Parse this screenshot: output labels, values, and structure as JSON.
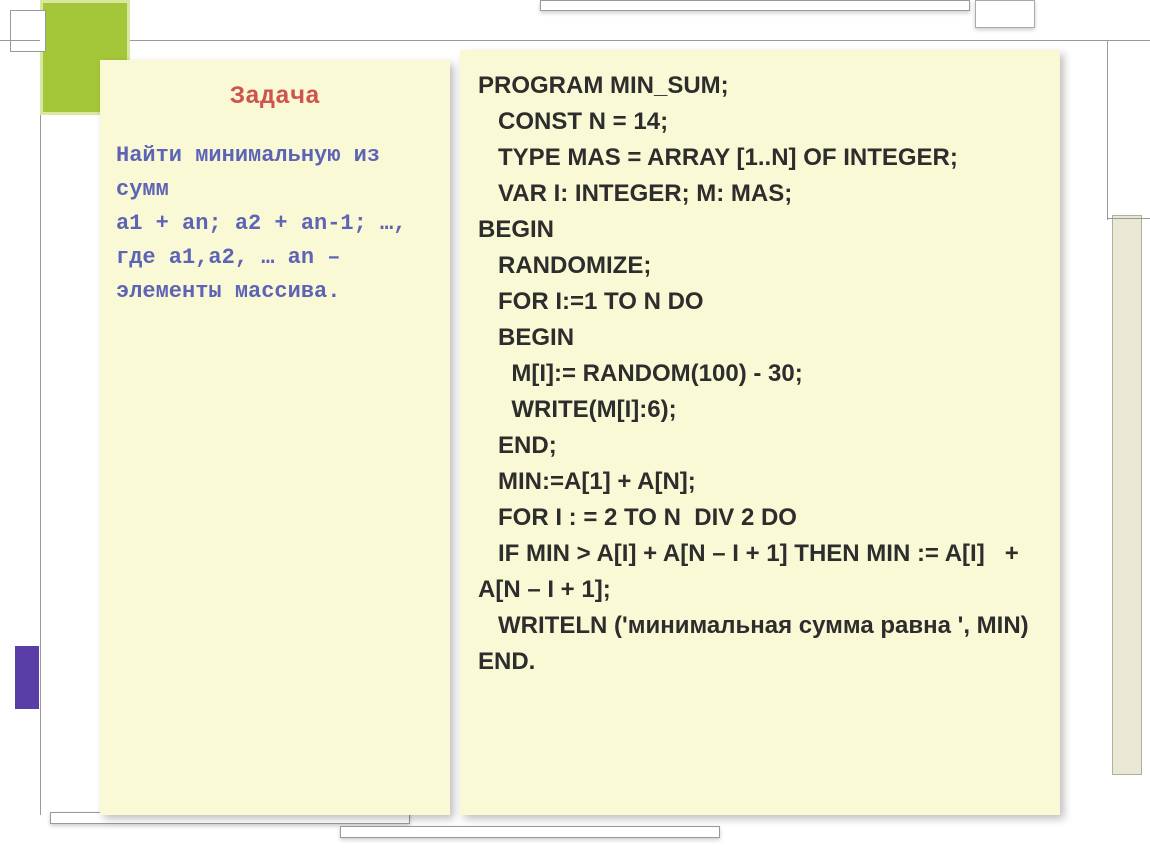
{
  "heading": "Задача",
  "task": {
    "l1": "Найти минимальную из сумм",
    "l2": "a1 + an; a2 + an-1; …, где a1,a2, … an – элементы массива."
  },
  "code": {
    "l01": "program min_sum;",
    "l02": "   const n = 14;",
    "l03": "   type mas = array [1..n] of integer;",
    "l04": "   var i: integer; m: mas;",
    "l05": "begin",
    "l06": "   randomize;",
    "l07": "   for i:=1 to n do",
    "l08": "   begin",
    "l09": "     m[i]:= random(100) - 30;",
    "l10": "     write(m[i]:6);",
    "l11": "   end;",
    "l12": "   min:=a[1] + a[n];",
    "l13": "   for i : = 2 to n  div 2 do",
    "l14": "   if min > a[i] + a[n – i + 1] then min := a[i]   + a[n – i + 1];",
    "l15_a": "   writeln ('",
    "l15_b": "минимальная сумма равна ",
    "l15_c": "', min)",
    "l16": "end."
  }
}
